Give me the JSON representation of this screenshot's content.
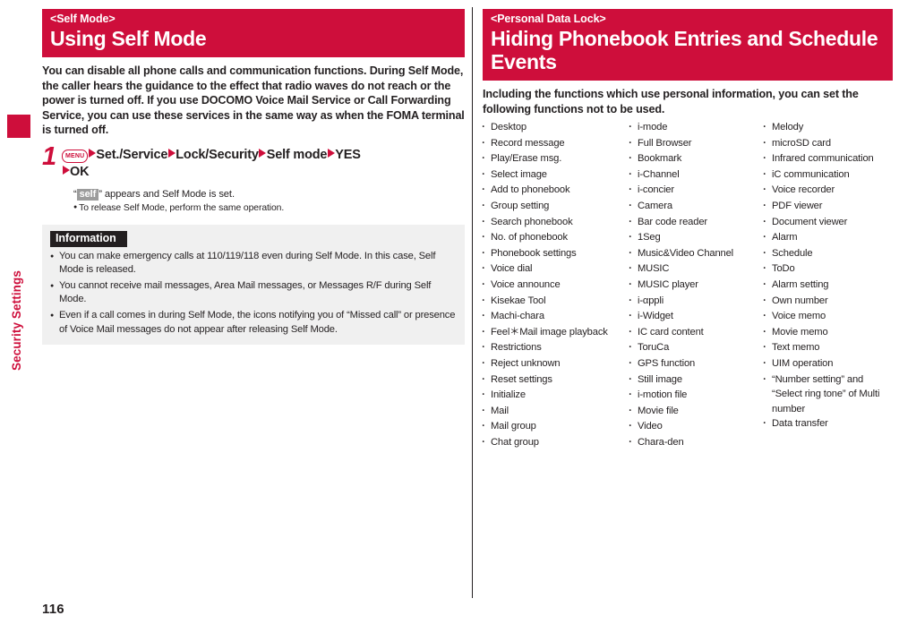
{
  "sidebar": {
    "chapter_label": "Security Settings"
  },
  "page_number": "116",
  "left_column": {
    "banner": {
      "eyebrow": "<Self Mode>",
      "title": "Using Self Mode"
    },
    "lead": "You can disable all phone calls and communication functions. During Self Mode, the caller hears the guidance to the effect that radio waves do not reach or the power is turned off. If you use DOCOMO Voice Mail Service or Call Forwarding Service, you can use these services in the same way as when the FOMA terminal is turned off.",
    "step": {
      "number": "1",
      "key_label": "MENU",
      "items": [
        "Set./Service",
        "Lock/Security",
        "Self mode",
        "YES",
        "OK"
      ],
      "note_prefix": "“",
      "note_chip": "self",
      "note_suffix": "” appears and Self Mode is set.",
      "note_bullet": "To release Self Mode, perform the same operation."
    },
    "information": {
      "title": "Information",
      "items": [
        "You can make emergency calls at 110/119/118 even during Self Mode. In this case, Self Mode is released.",
        "You cannot receive mail messages, Area Mail messages, or Messages R/F during Self Mode.",
        "Even if a call comes in during Self Mode, the icons notifying you of “Missed call” or presence of Voice Mail messages do not appear after releasing Self Mode."
      ]
    }
  },
  "right_column": {
    "banner": {
      "eyebrow": "<Personal Data Lock>",
      "title": "Hiding Phonebook Entries and Schedule Events"
    },
    "lead": "Including the functions which use personal information, you can set the following functions not to be used.",
    "function_columns": [
      [
        "Desktop",
        "Record message",
        "Play/Erase msg.",
        "Select image",
        "Add to phonebook",
        "Group setting",
        "Search phonebook",
        "No. of phonebook",
        "Phonebook settings",
        "Voice dial",
        "Voice announce",
        "Kisekae Tool",
        "Machi-chara",
        "Feel＊Mail image playback",
        "Restrictions",
        "Reject unknown",
        "Reset settings",
        "Initialize",
        "Mail",
        "Mail group",
        "Chat group"
      ],
      [
        "i-mode",
        "Full Browser",
        "Bookmark",
        "i-Channel",
        "i-concier",
        "Camera",
        "Bar code reader",
        "1Seg",
        "Music&Video Channel",
        "MUSIC",
        "MUSIC player",
        "i-αppli",
        "i-Widget",
        "IC card content",
        "ToruCa",
        "GPS function",
        "Still image",
        "i-motion file",
        "Movie file",
        "Video",
        "Chara-den"
      ],
      [
        "Melody",
        "microSD card",
        "Infrared communication",
        "iC communication",
        "Voice recorder",
        "PDF viewer",
        "Document viewer",
        "Alarm",
        "Schedule",
        "ToDo",
        "Alarm setting",
        "Own number",
        "Voice memo",
        "Movie memo",
        "Text memo",
        "UIM operation",
        "“Number setting” and “Select ring tone” of Multi number",
        "Data transfer"
      ]
    ]
  }
}
